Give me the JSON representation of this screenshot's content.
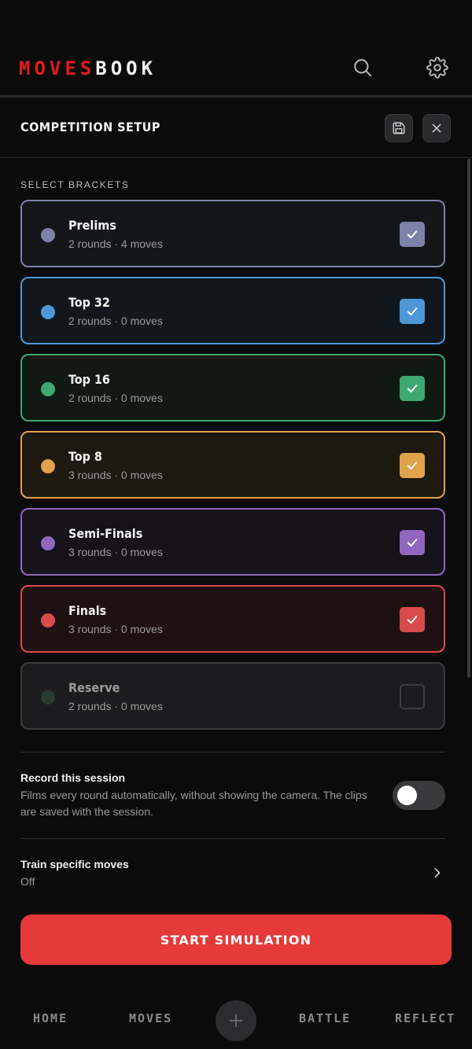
{
  "app": {
    "logo_part1": "MOVES",
    "logo_part2": "BOOK",
    "brand_color": "#e01b1b",
    "icons": [
      "search-icon",
      "gear-icon"
    ]
  },
  "setup": {
    "title": "COMPETITION SETUP",
    "actions": [
      "save-icon",
      "close-icon"
    ],
    "section_label": "SELECT BRACKETS"
  },
  "brackets": [
    {
      "name": "Prelims",
      "meta": "2 rounds · 4 moves",
      "color": "#7d82a8",
      "checked": true
    },
    {
      "name": "Top 32",
      "meta": "2 rounds · 0 moves",
      "color": "#4d97d6",
      "checked": true
    },
    {
      "name": "Top 16",
      "meta": "2 rounds · 0 moves",
      "color": "#3ea871",
      "checked": true
    },
    {
      "name": "Top 8",
      "meta": "3 rounds · 0 moves",
      "color": "#e0a24a",
      "checked": true
    },
    {
      "name": "Semi-Finals",
      "meta": "3 rounds · 0 moves",
      "color": "#9166bf",
      "checked": true
    },
    {
      "name": "Finals",
      "meta": "3 rounds · 0 moves",
      "color": "#d94a4a",
      "checked": true
    },
    {
      "name": "Reserve",
      "meta": "2 rounds · 0 moves",
      "color": "#2c3a32",
      "checked": false
    }
  ],
  "record": {
    "title": "Record this session",
    "description": "Films every round automatically, without showing the camera. The clips are saved with the session.",
    "enabled": false
  },
  "train": {
    "title": "Train specific moves",
    "value": "Off"
  },
  "start_button": "START SIMULATION",
  "nav": {
    "home": "HOME",
    "moves": "MOVES",
    "battle": "BATTLE",
    "reflect": "REFLECT"
  }
}
